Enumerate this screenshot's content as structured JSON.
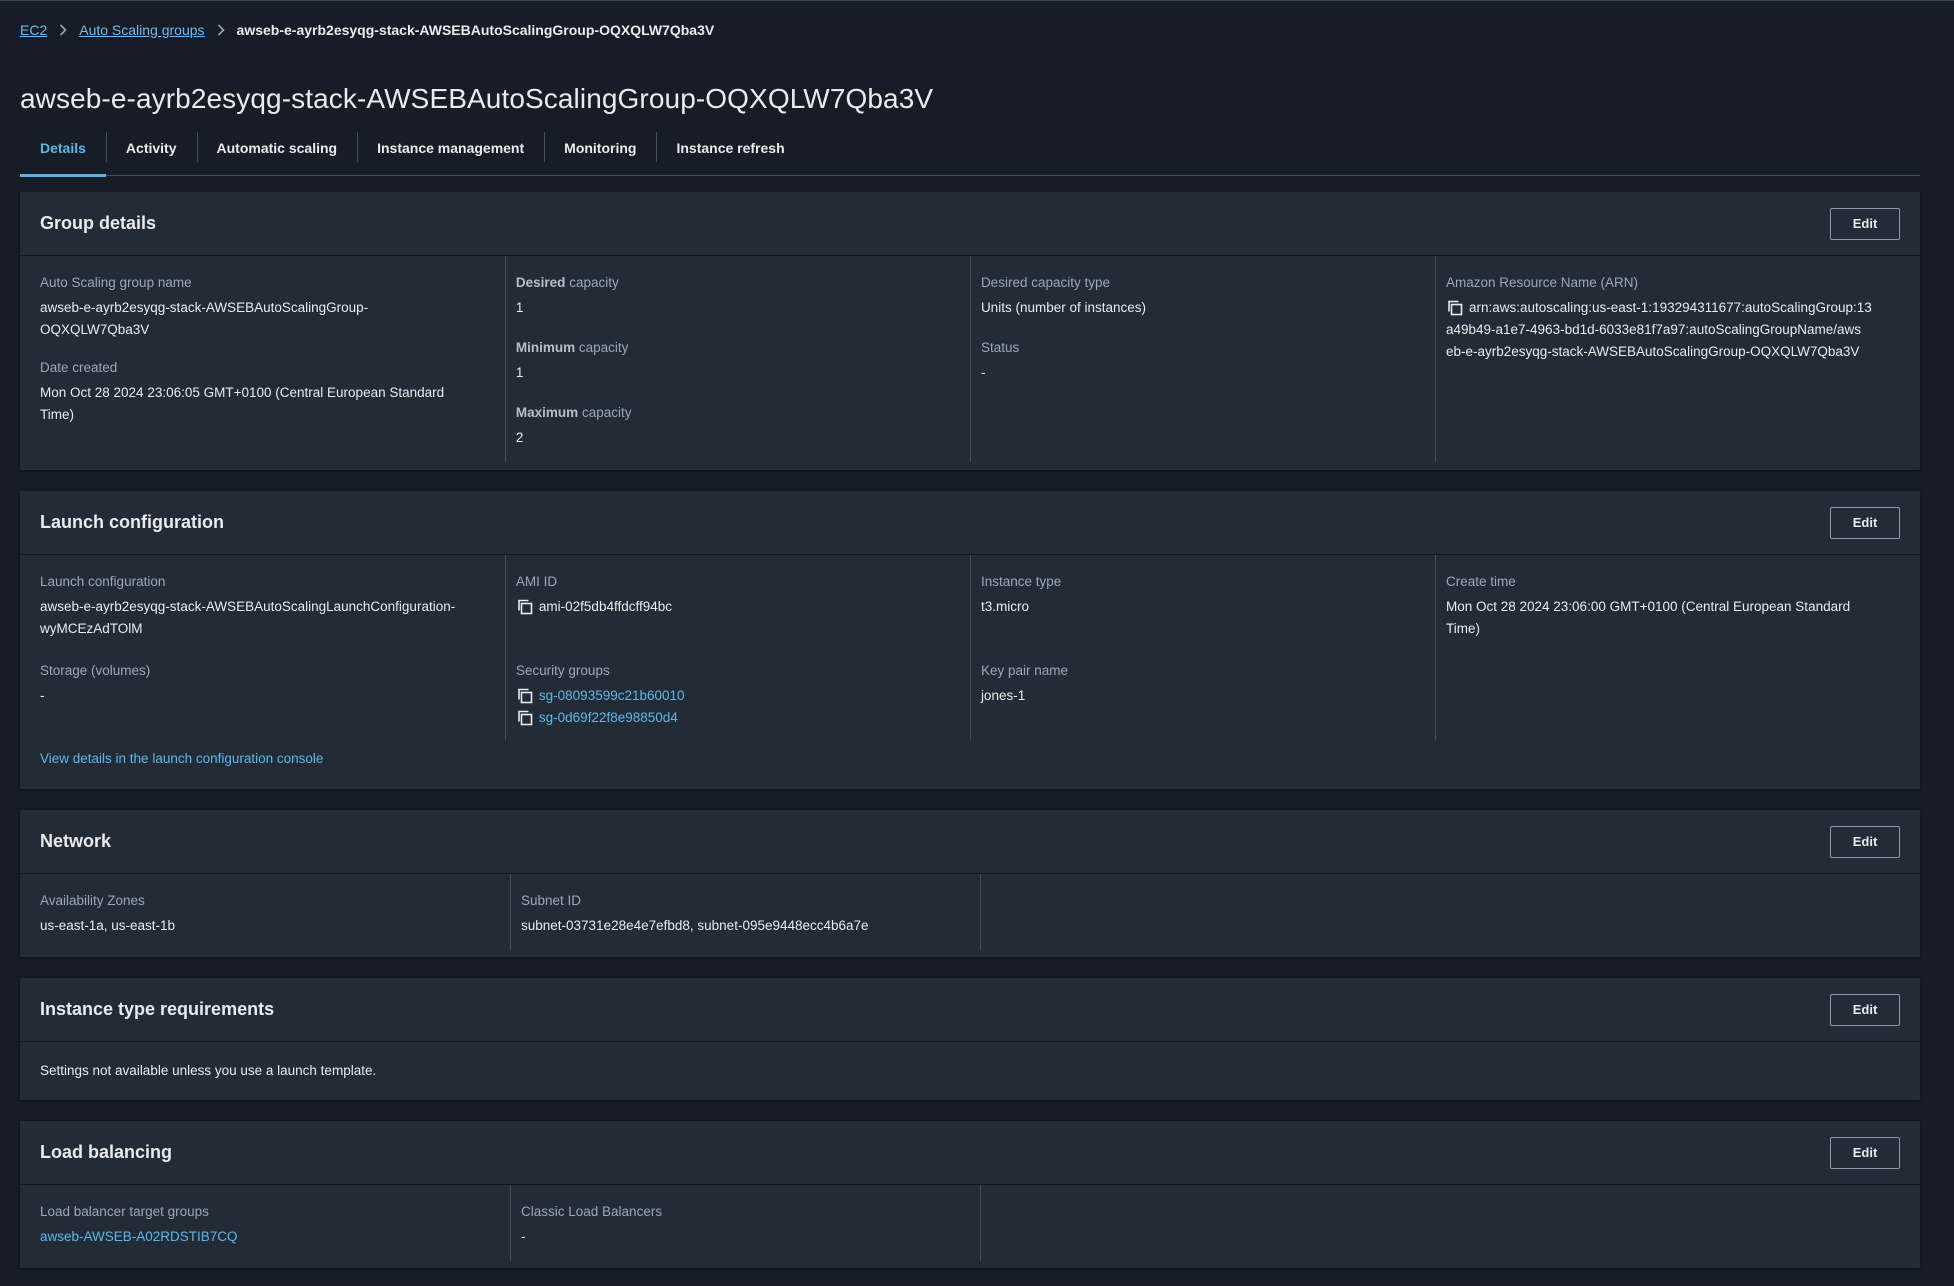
{
  "breadcrumb": {
    "root": "EC2",
    "parent": "Auto Scaling groups",
    "current": "awseb-e-ayrb2esyqg-stack-AWSEBAutoScalingGroup-OQXQLW7Qba3V"
  },
  "page_title": "awseb-e-ayrb2esyqg-stack-AWSEBAutoScalingGroup-OQXQLW7Qba3V",
  "tabs": [
    {
      "label": "Details",
      "active": true
    },
    {
      "label": "Activity"
    },
    {
      "label": "Automatic scaling"
    },
    {
      "label": "Instance management"
    },
    {
      "label": "Monitoring"
    },
    {
      "label": "Instance refresh"
    }
  ],
  "edit_label": "Edit",
  "group_details": {
    "title": "Group details",
    "asg_name_label": "Auto Scaling group name",
    "asg_name_line1": "awseb-e-ayrb2esyqg-stack-AWSEBAutoScalingGroup-",
    "asg_name_line2": "OQXQLW7Qba3V",
    "date_created_label": "Date created",
    "date_created_line1": "Mon Oct 28 2024 23:06:05 GMT+0100 (Central European Standard",
    "date_created_line2": "Time)",
    "desired_capacity_label_bold": "Desired",
    "desired_capacity_label_rest": " capacity",
    "desired_capacity": "1",
    "min_capacity_label_bold": "Minimum",
    "min_capacity_label_rest": " capacity",
    "min_capacity": "1",
    "max_capacity_label_bold": "Maximum",
    "max_capacity_label_rest": " capacity",
    "max_capacity": "2",
    "desired_type_label": "Desired capacity type",
    "desired_type": "Units (number of instances)",
    "status_label": "Status",
    "status": "-",
    "arn_label": "Amazon Resource Name (ARN)",
    "arn_line1": "arn:aws:autoscaling:us-east-1:193294311677:autoScalingGroup:13",
    "arn_line2": "a49b49-a1e7-4963-bd1d-6033e81f7a97:autoScalingGroupName/aws",
    "arn_line3": "eb-e-ayrb2esyqg-stack-AWSEBAutoScalingGroup-OQXQLW7Qba3V"
  },
  "launch_configuration": {
    "title": "Launch configuration",
    "lc_label": "Launch configuration",
    "lc_line1": "awseb-e-ayrb2esyqg-stack-AWSEBAutoScalingLaunchConfiguration-",
    "lc_line2": "wyMCEzAdTOlM",
    "storage_label": "Storage (volumes)",
    "storage": "-",
    "ami_label": "AMI ID",
    "ami": "ami-02f5db4ffdcff94bc",
    "sg_label": "Security groups",
    "sg1": "sg-08093599c21b60010",
    "sg2": "sg-0d69f22f8e98850d4",
    "instance_type_label": "Instance type",
    "instance_type": "t3.micro",
    "key_pair_label": "Key pair name",
    "key_pair": "jones-1",
    "create_time_label": "Create time",
    "create_time_line1": "Mon Oct 28 2024 23:06:00 GMT+0100 (Central European Standard",
    "create_time_line2": "Time)",
    "view_link": "View details in the launch configuration console"
  },
  "network": {
    "title": "Network",
    "az_label": "Availability Zones",
    "az": "us-east-1a, us-east-1b",
    "subnet_label": "Subnet ID",
    "subnet": "subnet-03731e28e4e7efbd8, subnet-095e9448ecc4b6a7e"
  },
  "instance_type_requirements": {
    "title": "Instance type requirements",
    "message": "Settings not available unless you use a launch template."
  },
  "load_balancing": {
    "title": "Load balancing",
    "tg_label": "Load balancer target groups",
    "tg": "awseb-AWSEB-A02RDSTIB7CQ",
    "clb_label": "Classic Load Balancers",
    "clb": "-"
  }
}
